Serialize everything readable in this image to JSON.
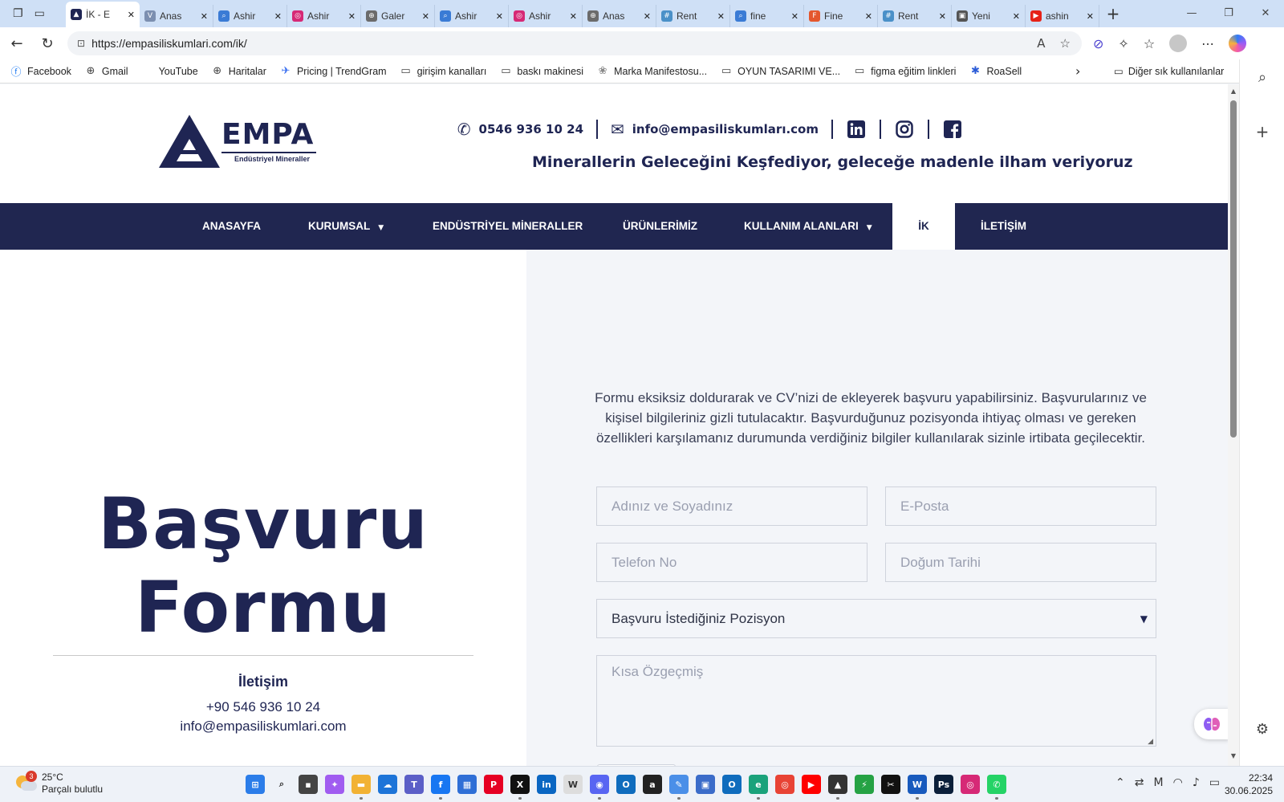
{
  "browser": {
    "tabs": [
      {
        "label": "İK - E",
        "color": "#1f2553",
        "glyph": "▲",
        "active": true
      },
      {
        "label": "Anas",
        "color": "#7c8fb0",
        "glyph": "V"
      },
      {
        "label": "Ashir",
        "color": "#3a7bd5",
        "glyph": "⌕"
      },
      {
        "label": "Ashir",
        "color": "#d62976",
        "glyph": "◎"
      },
      {
        "label": "Galer",
        "color": "#6b6b6b",
        "glyph": "⊕"
      },
      {
        "label": "Ashir",
        "color": "#3a7bd5",
        "glyph": "⌕"
      },
      {
        "label": "Ashir",
        "color": "#d62976",
        "glyph": "◎"
      },
      {
        "label": "Anas",
        "color": "#6b6b6b",
        "glyph": "⊕"
      },
      {
        "label": "Rent",
        "color": "#4a90c8",
        "glyph": "#"
      },
      {
        "label": "fine",
        "color": "#3a7bd5",
        "glyph": "⌕"
      },
      {
        "label": "Fine",
        "color": "#e4572e",
        "glyph": "F"
      },
      {
        "label": "Rent",
        "color": "#4a90c8",
        "glyph": "#"
      },
      {
        "label": "Yeni",
        "color": "#555555",
        "glyph": "▣"
      },
      {
        "label": "ashin",
        "color": "#e62117",
        "glyph": "▶"
      }
    ],
    "url": "https://empasiliskumlari.com/ik/",
    "bookmarks": [
      {
        "label": "Facebook",
        "icon": "facebook-icon",
        "glyph": "ⓕ",
        "color": "#1877f2"
      },
      {
        "label": "Gmail",
        "icon": "globe-icon",
        "glyph": "⊕",
        "color": "#444"
      },
      {
        "label": "YouTube",
        "icon": "youtube-icon",
        "glyph": " ",
        "color": "#444"
      },
      {
        "label": "Haritalar",
        "icon": "globe-icon",
        "glyph": "⊕",
        "color": "#444"
      },
      {
        "label": "Pricing | TrendGram",
        "icon": "trendgram-icon",
        "glyph": "✈",
        "color": "#3a6ff0"
      },
      {
        "label": "girişim kanalları",
        "icon": "folder-icon",
        "glyph": "▭",
        "color": "#444"
      },
      {
        "label": "baskı makinesi",
        "icon": "folder-icon",
        "glyph": "▭",
        "color": "#444"
      },
      {
        "label": "Marka Manifestosu...",
        "icon": "manifesto-icon",
        "glyph": "❀",
        "color": "#888"
      },
      {
        "label": "OYUN TASARIMI VE...",
        "icon": "folder-icon",
        "glyph": "▭",
        "color": "#444"
      },
      {
        "label": "figma eğitim linkleri",
        "icon": "folder-icon",
        "glyph": "▭",
        "color": "#444"
      },
      {
        "label": "RoaSell",
        "icon": "roasell-icon",
        "glyph": "✱",
        "color": "#2a5bd7"
      }
    ],
    "other_bookmarks": "Diğer sık kullanılanlar"
  },
  "site": {
    "logo_word": "EMPA",
    "logo_sub": "Endüstriyel Mineraller",
    "phone": "0546 936 10 24",
    "email": "info@empasiliskumları.com",
    "tagline": "Minerallerin Geleceğini Keşfediyor, geleceğe madenle ilham veriyoruz",
    "brand_color": "#1f2553",
    "menu": [
      {
        "label": "ANASAYFA",
        "caret": false
      },
      {
        "label": "KURUMSAL",
        "caret": true
      },
      {
        "label": "ENDÜSTRİYEL MİNERALLER",
        "caret": false
      },
      {
        "label": "ÜRÜNLERİMİZ",
        "caret": false
      },
      {
        "label": "KULLANIM ALANLARI",
        "caret": true
      },
      {
        "label": "İK",
        "caret": false,
        "active": true
      },
      {
        "label": "İLETİŞİM",
        "caret": false
      }
    ]
  },
  "left": {
    "title_line1": "Başvuru",
    "title_line2": "Formu",
    "contact_title": "İletişim",
    "contact_phone": "+90 546 936 10 24",
    "contact_email": "info@empasiliskumlari.com"
  },
  "form": {
    "intro": "Formu eksiksiz doldurarak ve CV’nizi de ekleyerek başvuru yapabilirsiniz. Başvurularınız ve kişisel bilgileriniz gizli tutulacaktır. Başvurduğunuz pozisyonda ihtiyaç olması ve gereken özellikleri karşılamanız durumunda verdiğiniz bilgiler kullanılarak sizinle irtibata geçilecektir.",
    "name_placeholder": "Adınız ve Soyadınız",
    "email_placeholder": "E-Posta",
    "phone_placeholder": "Telefon No",
    "birth_placeholder": "Doğum Tarihi",
    "position_selected": "Başvuru İstediğiniz Pozisyon",
    "cv_placeholder": "Kısa Özgeçmiş"
  },
  "taskbar": {
    "weather_temp": "25°C",
    "weather_desc": "Parçalı bulutlu",
    "weather_badge": "3",
    "time": "22:34",
    "date": "30.06.2025",
    "apps": [
      {
        "name": "start-icon",
        "color": "#2b7de9",
        "glyph": "⊞"
      },
      {
        "name": "search-icon",
        "color": "#eef2f8",
        "glyph": "⌕"
      },
      {
        "name": "task-view-icon",
        "color": "#444",
        "glyph": "▪"
      },
      {
        "name": "copilot-icon",
        "color": "#a05cf0",
        "glyph": "✦"
      },
      {
        "name": "file-explorer-icon",
        "color": "#f2b234",
        "glyph": "▬"
      },
      {
        "name": "onedrive-icon",
        "color": "#1d74d8",
        "glyph": "☁"
      },
      {
        "name": "teams-icon",
        "color": "#5b5fc7",
        "glyph": "T"
      },
      {
        "name": "facebook-app-icon",
        "color": "#1877f2",
        "glyph": "f"
      },
      {
        "name": "store-icon",
        "color": "#2f6fd6",
        "glyph": "▦"
      },
      {
        "name": "pinterest-icon",
        "color": "#e60023",
        "glyph": "P"
      },
      {
        "name": "x-icon",
        "color": "#111",
        "glyph": "X"
      },
      {
        "name": "linkedin-app-icon",
        "color": "#0a66c2",
        "glyph": "in"
      },
      {
        "name": "wikipedia-icon",
        "color": "#ddd",
        "glyph": "W"
      },
      {
        "name": "discord-icon",
        "color": "#5865f2",
        "glyph": "◉"
      },
      {
        "name": "outlook-icon",
        "color": "#0f6cbd",
        "glyph": "O"
      },
      {
        "name": "amazon-icon",
        "color": "#222",
        "glyph": "a"
      },
      {
        "name": "paint-icon",
        "color": "#4a8fe8",
        "glyph": "✎"
      },
      {
        "name": "save-icon",
        "color": "#3b6cc9",
        "glyph": "▣"
      },
      {
        "name": "outlook-new-icon",
        "color": "#0f6cbd",
        "glyph": "O"
      },
      {
        "name": "edge-icon",
        "color": "#1aa27b",
        "glyph": "e"
      },
      {
        "name": "chrome-icon",
        "color": "#e84335",
        "glyph": "◎"
      },
      {
        "name": "youtube-app-icon",
        "color": "#ff0000",
        "glyph": "▶"
      },
      {
        "name": "graduation-icon",
        "color": "#333",
        "glyph": "▲"
      },
      {
        "name": "green-app-icon",
        "color": "#25a244",
        "glyph": "⚡"
      },
      {
        "name": "capcut-icon",
        "color": "#111",
        "glyph": "✂"
      },
      {
        "name": "word-icon",
        "color": "#185abd",
        "glyph": "W"
      },
      {
        "name": "photoshop-icon",
        "color": "#0b1f3a",
        "glyph": "Ps"
      },
      {
        "name": "instagram-app-icon",
        "color": "#d62976",
        "glyph": "◎"
      },
      {
        "name": "whatsapp-icon",
        "color": "#25d366",
        "glyph": "✆"
      }
    ]
  }
}
